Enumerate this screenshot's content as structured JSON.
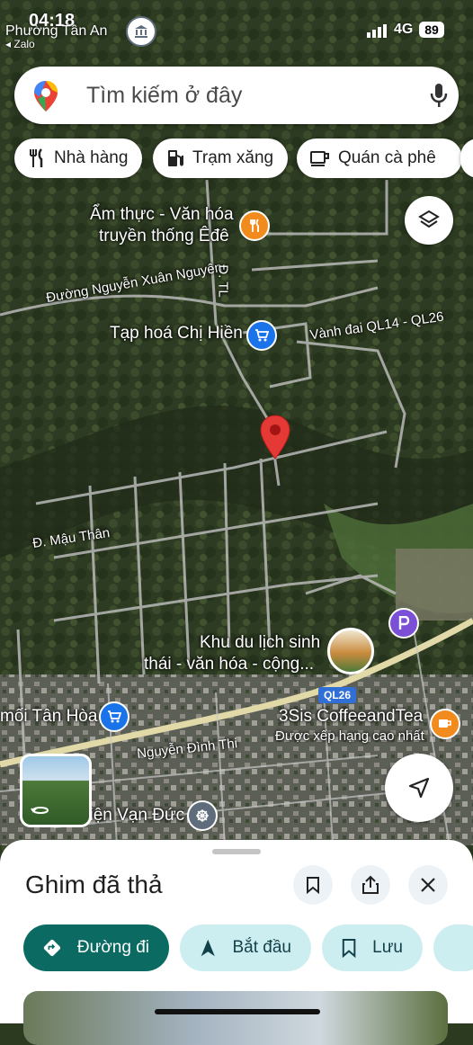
{
  "status_bar": {
    "time": "04:18",
    "location": "Phường Tân An",
    "back_app": "◂ Zalo",
    "network": "4G",
    "battery": "89"
  },
  "search": {
    "placeholder": "Tìm kiếm ở đây"
  },
  "chips": [
    {
      "label": "Nhà hàng",
      "icon": "restaurant-icon"
    },
    {
      "label": "Trạm xăng",
      "icon": "gas-station-icon"
    },
    {
      "label": "Quán cà phê",
      "icon": "coffee-icon"
    }
  ],
  "map_labels": {
    "poi_culinary_1": "Ẩm thực - Văn hóa",
    "poi_culinary_2": "truyền thống Êđê",
    "road_nguyen_xuan_nguyen": "Đường Nguyễn Xuân Nguyên",
    "road_dtl": "Đ. TL",
    "shop_chi_hien": "Tạp hoá Chị Hiền",
    "road_vanh_dai": "Vành đai QL14 - QL26",
    "road_mau_than": "Đ. Mậu Thân",
    "eco_park_1": "Khu du lịch sinh",
    "eco_park_2": "thái - văn hóa - cộng...",
    "route_shield": "QL26",
    "store_tan_hoa": "mối Tân Hòa",
    "cafe_name": "3Sis CoffeeandTea",
    "cafe_note": "Được xếp hạng cao nhất",
    "road_nguyen_dinh_thi": "Nguyễn Đình Thi",
    "temple": "viện Vạn Đức"
  },
  "sheet": {
    "title": "Ghim đã thả",
    "actions": [
      {
        "label": "Đường đi",
        "icon": "directions-icon"
      },
      {
        "label": "Bắt đầu",
        "icon": "navigate-icon"
      },
      {
        "label": "Lưu",
        "icon": "bookmark-icon"
      }
    ]
  },
  "colors": {
    "primary_action": "#0b6b63",
    "secondary_action": "#cdeef0",
    "pin_red": "#e53935",
    "poi_blue": "#1a73e8",
    "poi_orange": "#f28b1e"
  }
}
